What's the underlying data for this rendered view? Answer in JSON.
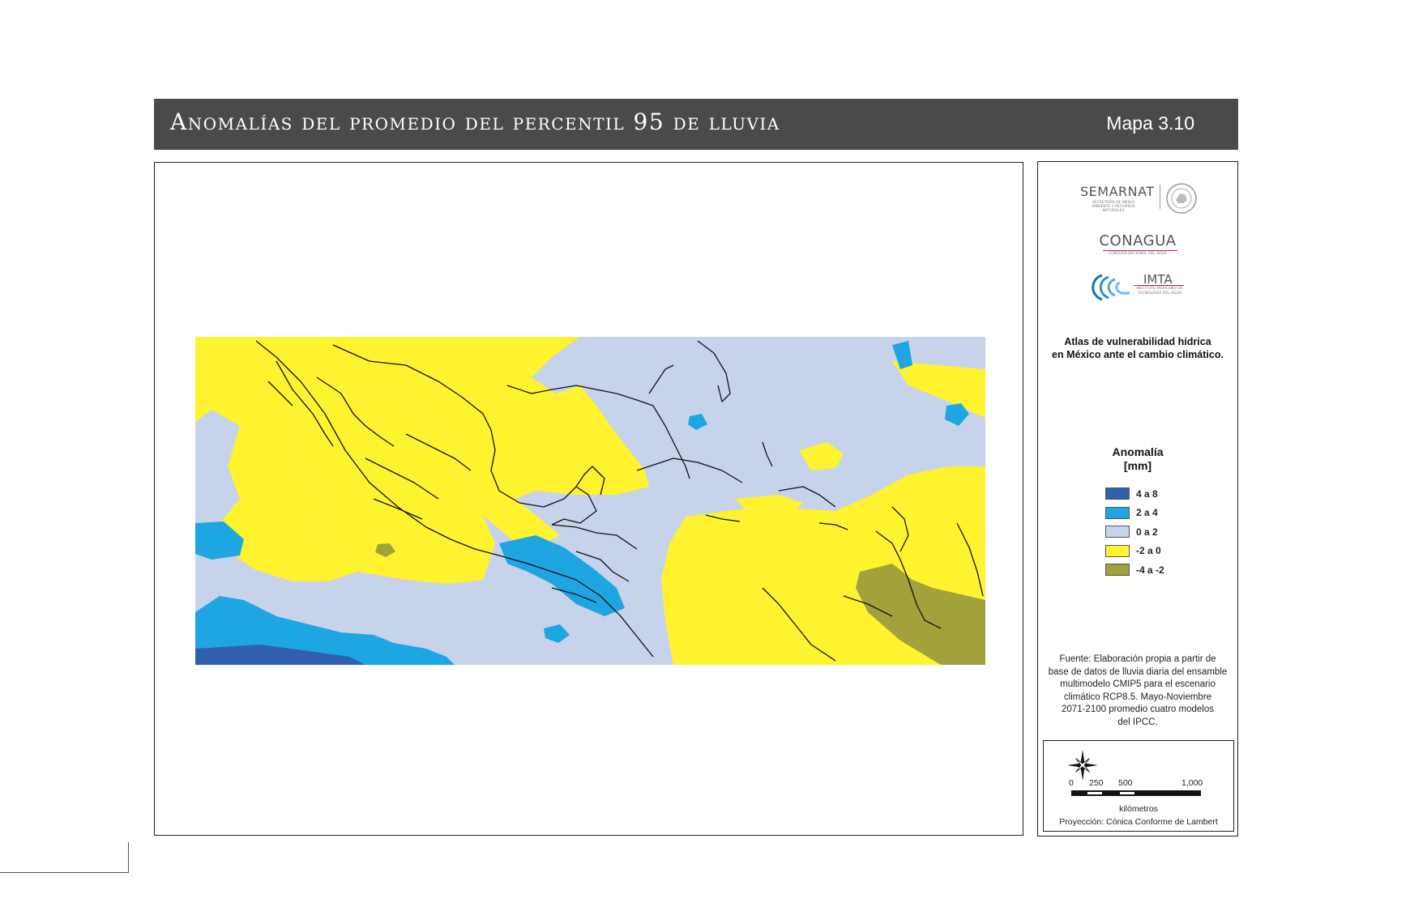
{
  "header": {
    "title": "Anomalías del promedio del percentil 95 de lluvia",
    "map_number": "Mapa 3.10"
  },
  "logos": {
    "semarnat": "SEMARNAT",
    "semarnat_sub": "SECRETARÍA DE MEDIO AMBIENTE Y RECURSOS NATURALES",
    "conagua": "CONAGUA",
    "conagua_sub": "COMISIÓN NACIONAL DEL AGUA",
    "imta": "IMTA",
    "imta_sub": "INSTITUTO MEXICANO DE TECNOLOGÍA DEL AGUA"
  },
  "atlas": {
    "line1": "Atlas de vulnerabilidad hídrica",
    "line2": "en México ante el cambio climático."
  },
  "legend": {
    "title_line1": "Anomalía",
    "title_line2": "[mm]",
    "items": [
      {
        "label": "4 a 8",
        "color": "#2f5fae"
      },
      {
        "label": "2 a 4",
        "color": "#1ea6e2"
      },
      {
        "label": "0 a 2",
        "color": "#c6d3ea"
      },
      {
        "label": "-2 a 0",
        "color": "#fff22e"
      },
      {
        "label": "-4 a -2",
        "color": "#a3a13c"
      }
    ]
  },
  "source": {
    "lines": [
      "Fuente: Elaboración propia a partir de",
      "base de datos de lluvia diaria del ensamble",
      "multimodelo CMIP5 para el escenario",
      "climático RCP8.5. Mayo-Noviembre",
      "2071-2100 promedio cuatro modelos",
      "del IPCC."
    ]
  },
  "scale": {
    "ticks": [
      "0",
      "250",
      "500",
      "1,000"
    ],
    "unit": "kilómetros",
    "projection": "Proyección: Cónica Conforme de Lambert"
  }
}
